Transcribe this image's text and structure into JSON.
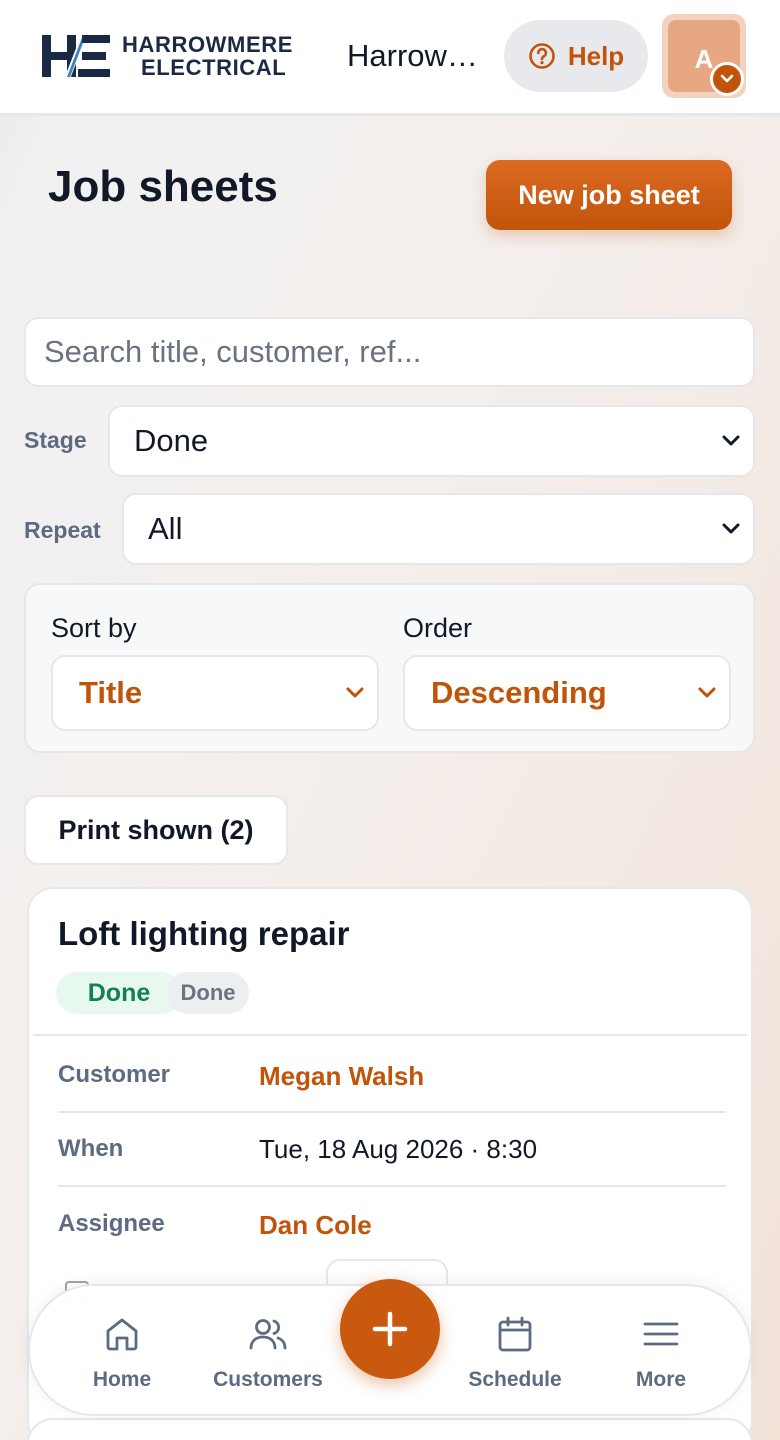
{
  "header": {
    "logo": {
      "line1": "HARROWMERE",
      "line2": "ELECTRICAL",
      "mark": "H/E"
    },
    "company_name": "Harrow…",
    "help_label": "Help",
    "help_icon": "question-circle-icon",
    "avatar_initial": "A",
    "avatar_caret_icon": "chevron-down-icon"
  },
  "page": {
    "title": "Job sheets",
    "new_button_label": "New job sheet"
  },
  "filters": {
    "search_placeholder": "Search title, customer, ref...",
    "search_value": "",
    "stage_label": "Stage",
    "stage_value": "Done",
    "repeat_label": "Repeat",
    "repeat_value": "All",
    "sort_by_label": "Sort by",
    "sort_by_value": "Title",
    "order_label": "Order",
    "order_value": "Descending",
    "print_label": "Print shown (2)"
  },
  "job_card": {
    "title": "Loft lighting repair",
    "status_badge": "Done",
    "stage_badge": "Done",
    "rows": [
      {
        "label": "Customer",
        "value": "Megan Walsh"
      },
      {
        "label": "When",
        "value": "Tue, 18 Aug 2026 · 8:30"
      },
      {
        "label": "Assignee",
        "value": "Dan Cole"
      }
    ]
  },
  "bottom_nav": {
    "items": [
      {
        "label": "Home",
        "icon": "home-icon"
      },
      {
        "label": "Customers",
        "icon": "users-icon"
      },
      {
        "label": "Schedule",
        "icon": "calendar-icon"
      },
      {
        "label": "More",
        "icon": "menu-icon"
      }
    ],
    "fab_icon": "plus-icon"
  },
  "colors": {
    "accent": "#c2540a",
    "navy": "#1b2a44",
    "success": "#13804e",
    "success_bg": "#e7f8ef",
    "muted": "#5d6b82"
  }
}
